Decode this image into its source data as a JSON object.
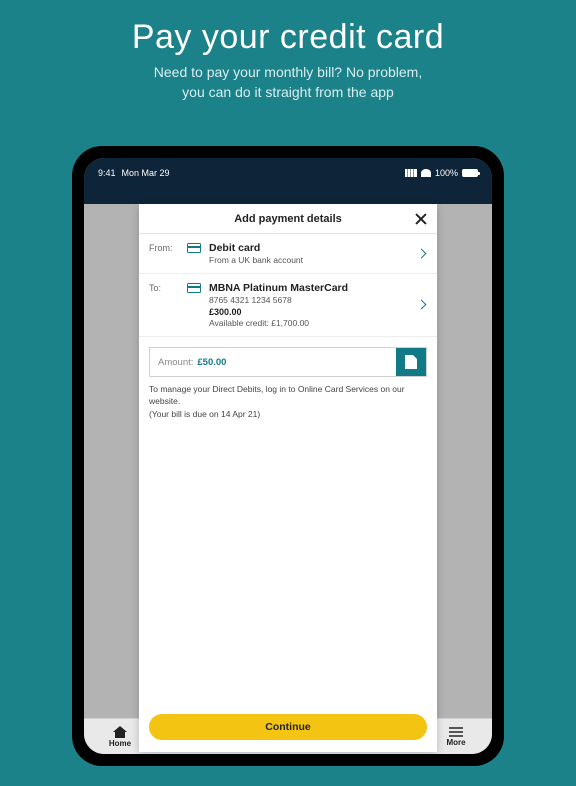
{
  "hero": {
    "title": "Pay your credit card",
    "line1": "Need to pay your monthly bill? No problem,",
    "line2": "you can do it straight from the app"
  },
  "statusbar": {
    "time": "9:41",
    "date": "Mon Mar 29",
    "battery": "100%"
  },
  "modal": {
    "title": "Add payment details",
    "from_label": "From:",
    "from_title": "Debit card",
    "from_sub": "From a UK bank account",
    "to_label": "To:",
    "to_title": "MBNA Platinum MasterCard",
    "to_number": "8765 4321 1234 5678",
    "to_balance": "£300.00",
    "to_available": "Available credit: £1,700.00",
    "amount_label": "Amount:",
    "amount_value": "£50.00",
    "note1": "To manage your Direct Debits, log in to Online Card Services on our website.",
    "note2": "(Your bill is due on 14 Apr 21)",
    "continue": "Continue"
  },
  "tabs": {
    "home": "Home",
    "more": "More"
  }
}
